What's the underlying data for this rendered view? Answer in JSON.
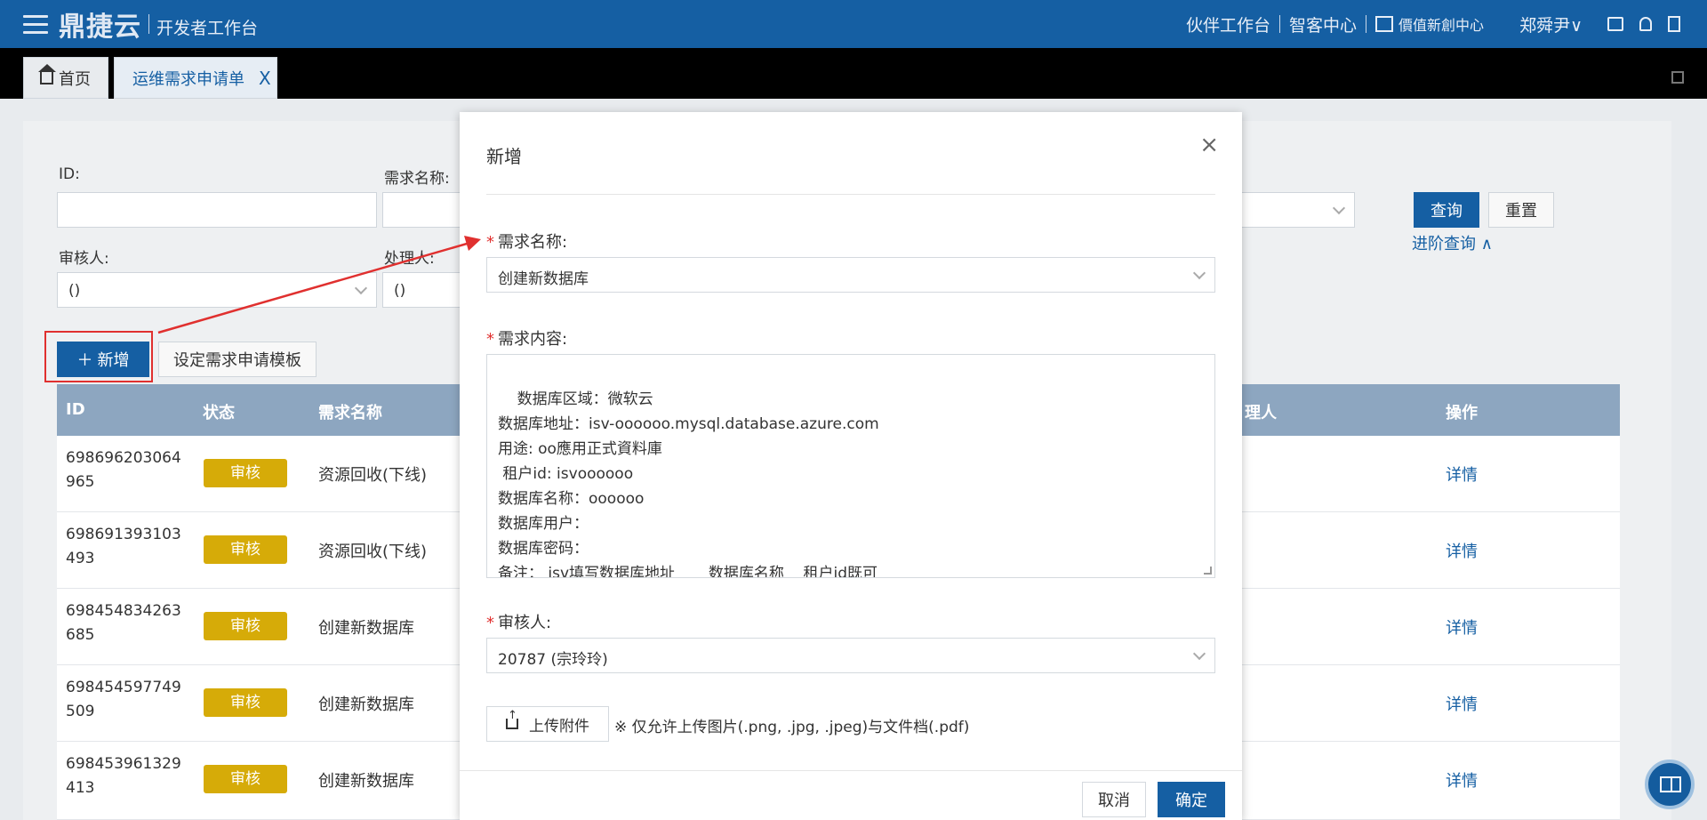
{
  "topbar": {
    "logo": "鼎捷云",
    "subtitle": "开发者工作台",
    "nav": [
      "伙伴工作台",
      "智客中心",
      "價值新創中心"
    ],
    "user": "郑舜尹"
  },
  "tabs": [
    {
      "label": "首页"
    },
    {
      "label": "运维需求申请单",
      "close": "X"
    }
  ],
  "filters": {
    "id_label": "ID:",
    "name_label": "需求名称:",
    "reviewer_label": "审核人:",
    "reviewer_value": "()",
    "handler_label": "处理人:",
    "handler_value": "()",
    "query_button": "查询",
    "reset_button": "重置",
    "advanced": "进阶查询 ∧"
  },
  "actions": {
    "add": "＋ 新增",
    "template": "设定需求申请模板"
  },
  "table": {
    "headers": [
      "ID",
      "状态",
      "需求名称",
      "理人",
      "操作"
    ],
    "rows": [
      {
        "id": "698696203064965",
        "status": "审核",
        "name": "资源回收(下线)",
        "action": "详情"
      },
      {
        "id": "698691393103493",
        "status": "审核",
        "name": "资源回收(下线)",
        "action": "详情"
      },
      {
        "id": "698454834263685",
        "status": "审核",
        "name": "创建新数据库",
        "action": "详情"
      },
      {
        "id": "698454597749509",
        "status": "审核",
        "name": "创建新数据库",
        "action": "详情"
      },
      {
        "id": "698453961329413",
        "status": "审核",
        "name": "创建新数据库",
        "action": "详情"
      }
    ]
  },
  "modal": {
    "title": "新增",
    "close": "×",
    "name_label": "需求名称:",
    "name_value": "创建新数据库",
    "content_label": "需求内容:",
    "content_value": "数据库区域：微软云\n数据库地址：isv-oooooo.mysql.database.azure.com\n用途: oo應用正式資料庫\n 租户id: isvoooooo\n数据库名称：oooooo\n数据库用户：\n数据库密码：\n备注： isv填写数据库地址       数据库名称    租户id既可",
    "reviewer_label": "审核人:",
    "reviewer_value": "20787 (宗玲玲)",
    "upload_button": "上传附件",
    "upload_note": "※ 仅允许上传图片(.png, .jpg, .jpeg)与文件档(.pdf)",
    "cancel": "取消",
    "confirm": "确定"
  },
  "colors": {
    "brand": "#155fa3",
    "status_badge": "#d6ab08",
    "annotation_red": "#e0302f"
  }
}
